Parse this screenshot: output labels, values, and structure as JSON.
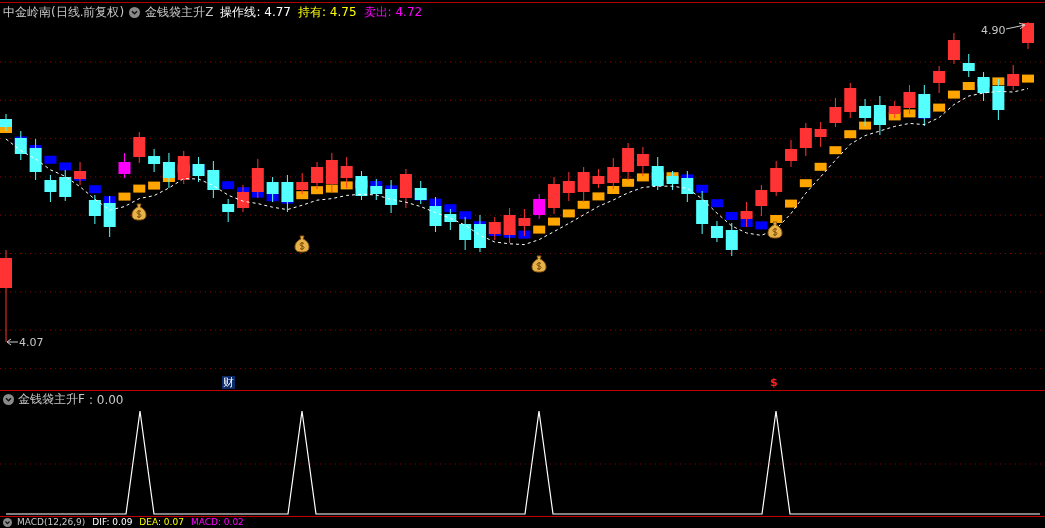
{
  "header": {
    "title": "中金岭南(日线.前复权)",
    "indicator": "金钱袋主升Z",
    "readings": [
      {
        "label": "操作线:",
        "value": "4.77",
        "kind": "line"
      },
      {
        "label": "持有:",
        "value": "4.75",
        "kind": "hold"
      },
      {
        "label": "卖出:",
        "value": "4.72",
        "kind": "sell"
      }
    ]
  },
  "price_labels": {
    "high": "4.90",
    "low": "4.07"
  },
  "markers": [
    {
      "text": "财",
      "kind": "finance"
    },
    {
      "text": "$",
      "kind": "dollar"
    }
  ],
  "sub_panel": {
    "title": "金钱袋主升F",
    "value": ": 0.00"
  },
  "macd": {
    "title": "MACD(12,26,9)",
    "readings": [
      {
        "label": "DIF:",
        "value": "0.09",
        "kind": "dif"
      },
      {
        "label": "DEA:",
        "value": "0.07",
        "kind": "dea"
      },
      {
        "label": "MACD:",
        "value": "0.02",
        "kind": "macd"
      }
    ]
  }
}
